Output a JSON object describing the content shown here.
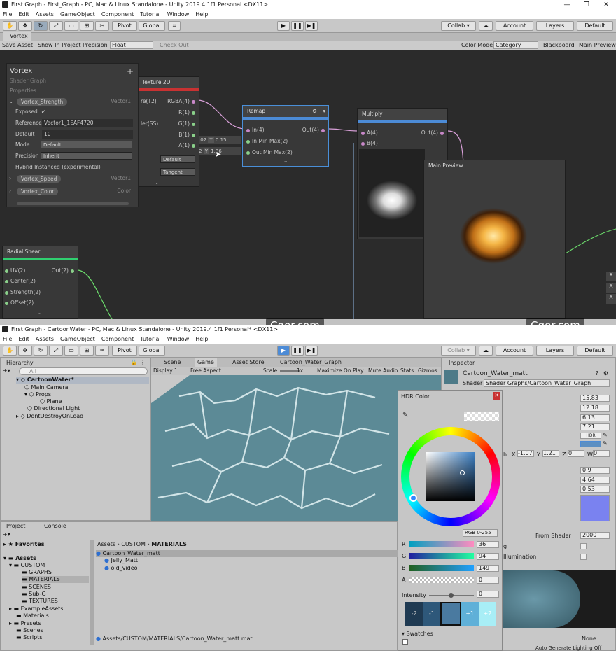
{
  "top": {
    "window_title": "First Graph - First_Graph - PC, Mac & Linux Standalone - Unity 2019.4.1f1 Personal <DX11>",
    "menu": [
      "File",
      "Edit",
      "Assets",
      "GameObject",
      "Component",
      "Tutorial",
      "Window",
      "Help"
    ],
    "toolbar": {
      "pivot": "Pivot",
      "global": "Global",
      "collab": "Collab ▾",
      "account": "Account",
      "layers": "Layers",
      "layout": "Default"
    },
    "tab": "Vortex",
    "graph_toolbar": {
      "save": "Save Asset",
      "show": "Show In Project",
      "precision_label": "Precision",
      "precision_value": "Float",
      "checkout": "Check Out",
      "color_mode_label": "Color Mode",
      "color_mode_value": "Category",
      "blackboard": "Blackboard",
      "main_preview": "Main Preview"
    },
    "blackboard": {
      "title": "Vortex",
      "subtitle": "Shader Graph",
      "section": "Properties",
      "prop1": "Vortex_Strength",
      "prop1_type": "Vector1",
      "exposed": "Exposed",
      "reference_label": "Reference",
      "reference": "Vector1_1EAF4720",
      "default_label": "Default",
      "default": "10",
      "mode_label": "Mode",
      "mode": "Default",
      "precision_label": "Precision",
      "precision": "Inherit",
      "hybrid": "Hybrid Instanced (experimental)",
      "prop2": "Vortex_Speed",
      "prop2_type": "Vector1",
      "prop3": "Vortex_Color",
      "prop3_type": "Color"
    },
    "texture_node": {
      "title": "Texture 2D",
      "in1": "re(T2)",
      "in2": "ler(SS)",
      "out_rgba": "RGBA(4)",
      "out_r": "R(1)",
      "out_g": "G(1)",
      "out_b": "B(1)",
      "out_a": "A(1)",
      "drop1": "Default",
      "drop2": "Tangent"
    },
    "remap_node": {
      "title": "Remap",
      "in": "In(4)",
      "inminmax": "In Min Max(2)",
      "outminmax": "Out Min Max(2)",
      "out": "Out(4)",
      "y1_label": "Y",
      "y1": "0.15",
      "y2_label": "Y",
      "y2": "1.36",
      "x1": ".02",
      "x2": "2"
    },
    "multiply_node": {
      "title": "Multiply",
      "a": "A(4)",
      "b": "B(4)",
      "out": "Out(4)"
    },
    "main_preview": {
      "title": "Main Preview"
    },
    "radial_node": {
      "title": "Radial Shear",
      "uv": "UV(2)",
      "center": "Center(2)",
      "strength": "Strength(2)",
      "offset": "Offset(2)",
      "out": "Out(2)"
    },
    "side_buttons": [
      "X",
      "X",
      "X"
    ]
  },
  "watermark": "Cger.com",
  "bottom": {
    "window_title": "First Graph - CartoonWater - PC, Mac & Linux Standalone - Unity 2019.4.1f1 Personal* <DX11>",
    "menu": [
      "File",
      "Edit",
      "Assets",
      "GameObject",
      "Component",
      "Tutorial",
      "Window",
      "Help"
    ],
    "toolbar": {
      "pivot": "Pivot",
      "global": "Global",
      "collab": "Collab ▾",
      "account": "Account",
      "layers": "Layers",
      "layout": "Default"
    },
    "hierarchy": {
      "tab": "Hierarchy",
      "search": "All",
      "items": [
        "CartoonWater*",
        "Main Camera",
        "Props",
        "Plane",
        "Directional Light",
        "DontDestroyOnLoad"
      ]
    },
    "scene_tabs": [
      "Scene",
      "Game",
      "Asset Store",
      "Cartoon_Water_Graph"
    ],
    "game_toolbar": {
      "display": "Display 1",
      "aspect": "Free Aspect",
      "scale_label": "Scale",
      "scale": "1x",
      "maximize": "Maximize On Play",
      "mute": "Mute Audio",
      "stats": "Stats",
      "gizmos": "Gizmos"
    },
    "inspector": {
      "tab": "Inspector",
      "name": "Cartoon_Water_matt",
      "shader_label": "Shader",
      "shader": "Shader Graphs/Cartoon_Water_Graph",
      "values": [
        "15.83",
        "12.18",
        "6.13",
        "7.21"
      ],
      "hdr": "HDR",
      "vx_label": "X",
      "vx": "-1.07",
      "vy_label": "Y",
      "vy": "1.21",
      "vz_label": "Z",
      "vz": "0",
      "vw_label": "W",
      "vw": "0",
      "h": "h",
      "vals2": [
        "0.9",
        "4.64",
        "0.53"
      ],
      "from_shader": "From Shader",
      "queue": "2000",
      "g": "g",
      "illum": "Illumination",
      "none": "None",
      "auto_light": "Auto Generate Lighting Off"
    },
    "project": {
      "tab1": "Project",
      "tab2": "Console",
      "favorites": "Favorites",
      "assets": "Assets",
      "tree": [
        "CUSTOM",
        "GRAPHS",
        "MATERIALS",
        "SCENES",
        "Sub-G",
        "TEXTURES",
        "ExampleAssets",
        "Materials",
        "Presets",
        "Scenes",
        "Scripts"
      ],
      "breadcrumb": [
        "Assets",
        "CUSTOM",
        "MATERIALS"
      ],
      "files": [
        "Cartoon_Water_matt",
        "Jelly_Matt",
        "old_video"
      ],
      "path": "Assets/CUSTOM/MATERIALS/Cartoon_Water_matt.mat"
    },
    "hdr_color": {
      "title": "HDR Color",
      "mode": "RGB 0-255",
      "r_label": "R",
      "r": "36",
      "g_label": "G",
      "g": "94",
      "b_label": "B",
      "b": "149",
      "a_label": "A",
      "a": "0",
      "intensity_label": "Intensity",
      "intensity": "0",
      "swatches_label": "Swatches",
      "stops": [
        "-2",
        "-1",
        "",
        "+1",
        "+2"
      ]
    }
  },
  "colors": {
    "accent_blue": "#4c8bd6",
    "green_bar": "#30d070",
    "red_bar": "#c83232",
    "hdr_blue": "#7a82f0"
  }
}
